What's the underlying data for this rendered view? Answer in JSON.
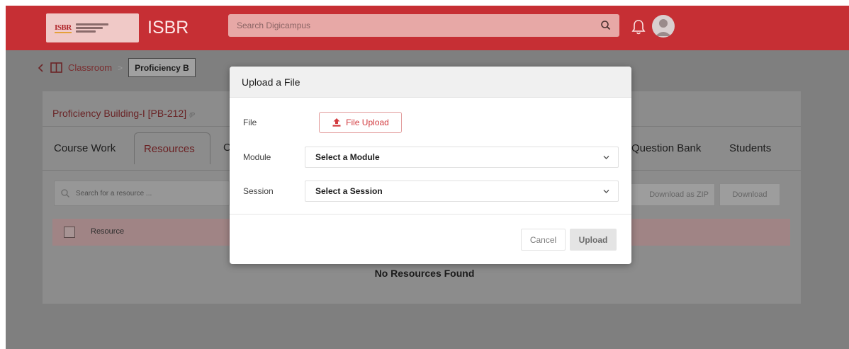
{
  "header": {
    "logo_text": "ISBR",
    "brand": "ISBR",
    "search_placeholder": "Search Digicampus",
    "colors": {
      "bar": "#c62f34",
      "accent": "#d23b3f"
    },
    "icons": [
      "search-icon",
      "bell-icon",
      "avatar"
    ]
  },
  "breadcrumb": {
    "parent": "Classroom",
    "current": "Proficiency B"
  },
  "course": {
    "title": "Proficiency Building-I [PB-212]",
    "code_tag": "(P"
  },
  "tabs": {
    "course_work": "Course Work",
    "resources": "Resources",
    "partial": "C",
    "question_bank": "Question Bank",
    "students": "Students"
  },
  "resources": {
    "search_placeholder": "Search for a resource ...",
    "download_zip": "Download as ZIP",
    "download": "Download",
    "column": "Resource",
    "empty": "No Resources Found"
  },
  "modal": {
    "title": "Upload a File",
    "file_label": "File",
    "file_button": "File Upload",
    "module_label": "Module",
    "module_value": "Select a Module",
    "session_label": "Session",
    "session_value": "Select a Session",
    "cancel": "Cancel",
    "submit": "Upload"
  }
}
